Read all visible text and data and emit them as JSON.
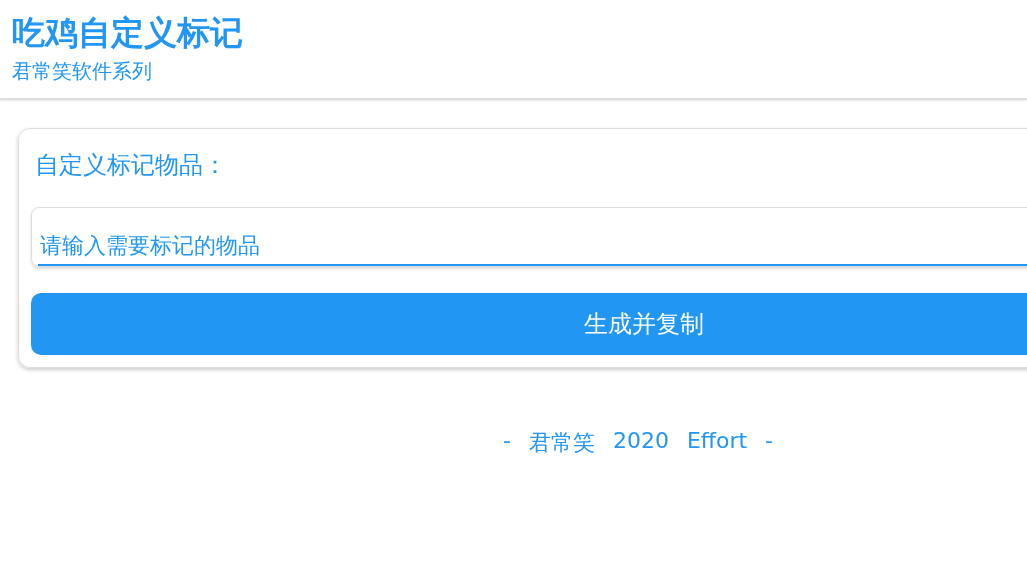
{
  "header": {
    "title": "吃鸡自定义标记",
    "subtitle": "君常笑软件系列"
  },
  "form": {
    "label": "自定义标记物品：",
    "input": {
      "placeholder": "请输入需要标记的物品"
    },
    "button": "生成并复制"
  },
  "footer": [
    "-",
    "君常笑",
    "2020",
    "Effort",
    "-"
  ]
}
